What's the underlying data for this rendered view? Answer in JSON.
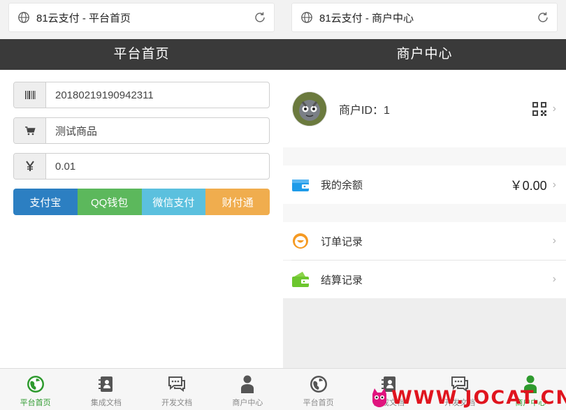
{
  "left": {
    "browser_title": "81云支付 - 平台首页",
    "header_title": "平台首页",
    "fields": {
      "order_no": "20180219190942311",
      "product_name": "测试商品",
      "amount": "0.01"
    },
    "pay_buttons": [
      {
        "label": "支付宝",
        "color": "#2c7fc2"
      },
      {
        "label": "QQ钱包",
        "color": "#5cb85c"
      },
      {
        "label": "微信支付",
        "color": "#5bc0de"
      },
      {
        "label": "财付通",
        "color": "#f0ad4e"
      }
    ],
    "tabs": [
      {
        "label": "平台首页",
        "icon": "globe-icon",
        "active": true
      },
      {
        "label": "集成文档",
        "icon": "address-book-icon",
        "active": false
      },
      {
        "label": "开发文档",
        "icon": "chat-bubbles-icon",
        "active": false
      },
      {
        "label": "商户中心",
        "icon": "user-icon",
        "active": false
      }
    ]
  },
  "right": {
    "browser_title": "81云支付 - 商户中心",
    "header_title": "商户中心",
    "merchant_id_label": "商户ID：1",
    "balance": {
      "label": "我的余额",
      "value": "￥0.00"
    },
    "order_records_label": "订单记录",
    "settle_records_label": "结算记录",
    "tabs": [
      {
        "label": "平台首页",
        "icon": "globe-icon",
        "active": false
      },
      {
        "label": "集成文档",
        "icon": "address-book-icon",
        "active": false
      },
      {
        "label": "开发文档",
        "icon": "chat-bubbles-icon",
        "active": false
      },
      {
        "label": "商户中心",
        "icon": "user-icon",
        "active": true
      }
    ]
  },
  "watermark": "WWW.JOCAT.CN",
  "colors": {
    "header_bg": "#3a3a3a",
    "active_tab": "#2e9a2e",
    "inactive_tab": "#555555"
  }
}
